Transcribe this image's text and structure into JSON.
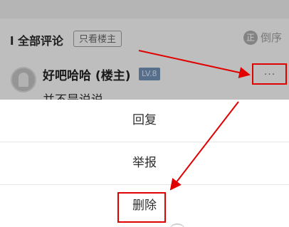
{
  "section": {
    "title": "l 全部评论",
    "filter_label": "只看楼主",
    "sort_icon_glyph": "正",
    "sort_label": "倒序"
  },
  "comment": {
    "user_name": "好吧哈哈 (楼主)",
    "level": "LV.8",
    "text": "并不是说说",
    "more_label": "···"
  },
  "action_sheet": {
    "items": [
      "回复",
      "举报",
      "删除"
    ]
  },
  "annotation": {
    "color": "#e10000"
  }
}
